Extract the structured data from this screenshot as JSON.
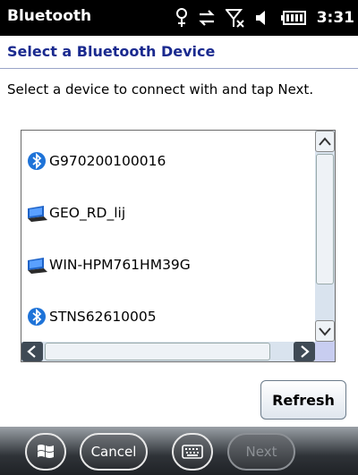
{
  "window": {
    "title": "Bluetooth",
    "clock": "3:31"
  },
  "status_icons": [
    "signal-antenna-icon",
    "data-sync-icon",
    "no-signal-icon",
    "speaker-muted-icon",
    "battery-icon"
  ],
  "header": {
    "title": "Select a Bluetooth Device"
  },
  "instruction": "Select a device to connect with and tap Next.",
  "devices": [
    {
      "name": "G970200100016",
      "icon": "bluetooth-icon"
    },
    {
      "name": "GEO_RD_lij",
      "icon": "computer-icon"
    },
    {
      "name": "WIN-HPM761HM39G",
      "icon": "computer-icon"
    },
    {
      "name": "STNS62610005",
      "icon": "bluetooth-icon"
    }
  ],
  "actions": {
    "refresh_label": "Refresh"
  },
  "bottom_bar": {
    "cancel_label": "Cancel",
    "next_label": "Next"
  },
  "colors": {
    "header_text": "#1a2a8f",
    "titlebar_bg": "#000000",
    "bluetooth": "#1e73d8"
  }
}
